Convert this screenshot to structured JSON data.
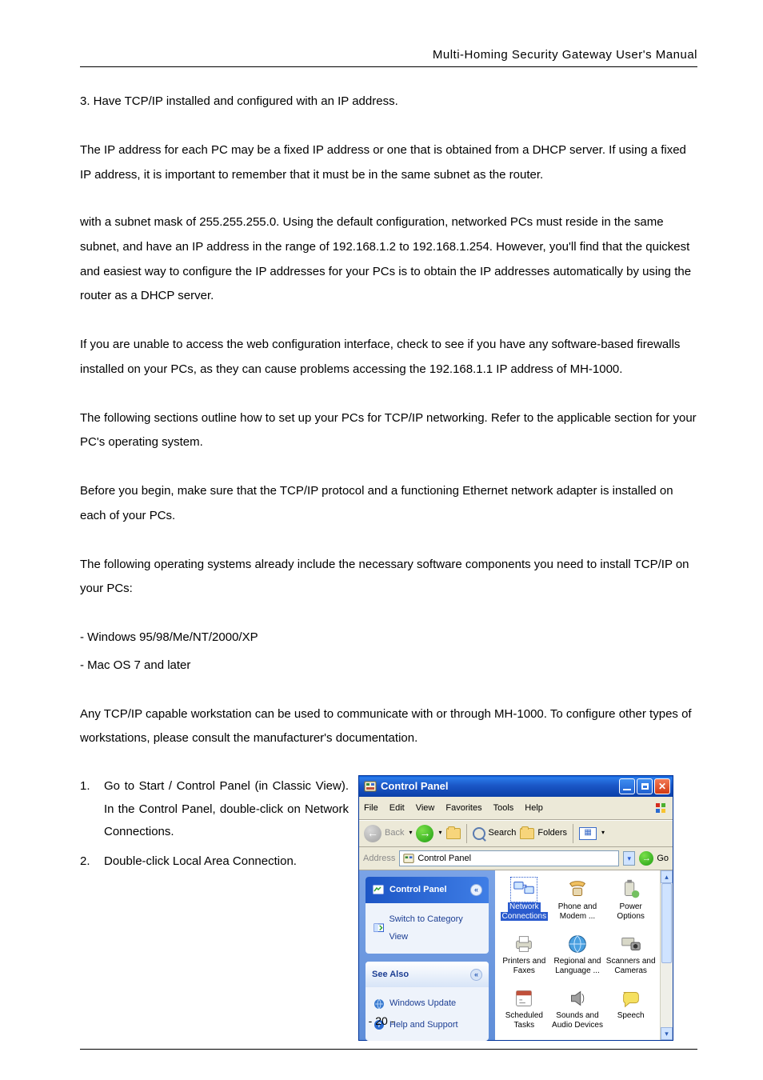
{
  "header": {
    "running_title": "Multi-Homing Security Gateway User's Manual"
  },
  "body": {
    "p1": "3. Have TCP/IP installed and configured with an IP address.",
    "p2": "The IP address for each PC may be a fixed IP address or one that is obtained from a DHCP server. If using a fixed IP address, it is important to remember that it must be in the same subnet as the router.",
    "p2b": "with a subnet mask of 255.255.255.0. Using the default configuration, networked PCs must reside in the same subnet, and have an IP address in the range of 192.168.1.2 to 192.168.1.254. However, you'll find that the quickest and easiest way to configure the IP addresses for your PCs is to obtain the IP addresses automatically by using the router as a DHCP server.",
    "p3": "If you are unable to access the web configuration interface, check to see if you have any software-based firewalls installed on your PCs, as they can cause problems accessing the 192.168.1.1 IP address of MH-1000.",
    "p4": "The following sections outline how to set up your PCs for TCP/IP networking. Refer to the applicable section for your PC's operating system.",
    "p5": "Before you begin, make sure that the TCP/IP protocol and a functioning Ethernet network adapter is installed on each of your PCs.",
    "p6": "The following operating systems already include the necessary software components you need to install TCP/IP on your PCs:",
    "li1": "- Windows 95/98/Me/NT/2000/XP",
    "li2": "- Mac OS 7 and later",
    "p7": "Any TCP/IP capable workstation can be used to communicate with or through MH-1000. To configure other types of workstations, please consult the manufacturer's documentation.",
    "steps": {
      "n1": "1.",
      "t1": "Go to Start / Control Panel (in Classic View). In the Control Panel, double-click on Network Connections.",
      "n2": "2.",
      "t2": "Double-click Local Area Connection."
    }
  },
  "win": {
    "title": "Control Panel",
    "menus": [
      "File",
      "Edit",
      "View",
      "Favorites",
      "Tools",
      "Help"
    ],
    "toolbar": {
      "back": "Back",
      "search": "Search",
      "folders": "Folders"
    },
    "address": {
      "label": "Address",
      "value": "Control Panel",
      "go": "Go"
    },
    "side": {
      "panel_title": "Control Panel",
      "switch": "Switch to Category View",
      "see_also": "See Also",
      "links": [
        "Windows Update",
        "Help and Support"
      ]
    },
    "items": [
      {
        "label1": "Network",
        "label2": "Connections"
      },
      {
        "label1": "Phone and",
        "label2": "Modem ..."
      },
      {
        "label1": "Power Options",
        "label2": ""
      },
      {
        "label1": "Printers and",
        "label2": "Faxes"
      },
      {
        "label1": "Regional and",
        "label2": "Language ..."
      },
      {
        "label1": "Scanners and",
        "label2": "Cameras"
      },
      {
        "label1": "Scheduled",
        "label2": "Tasks"
      },
      {
        "label1": "Sounds and",
        "label2": "Audio Devices"
      },
      {
        "label1": "Speech",
        "label2": ""
      }
    ]
  },
  "footer": {
    "page": "- 20 -"
  }
}
